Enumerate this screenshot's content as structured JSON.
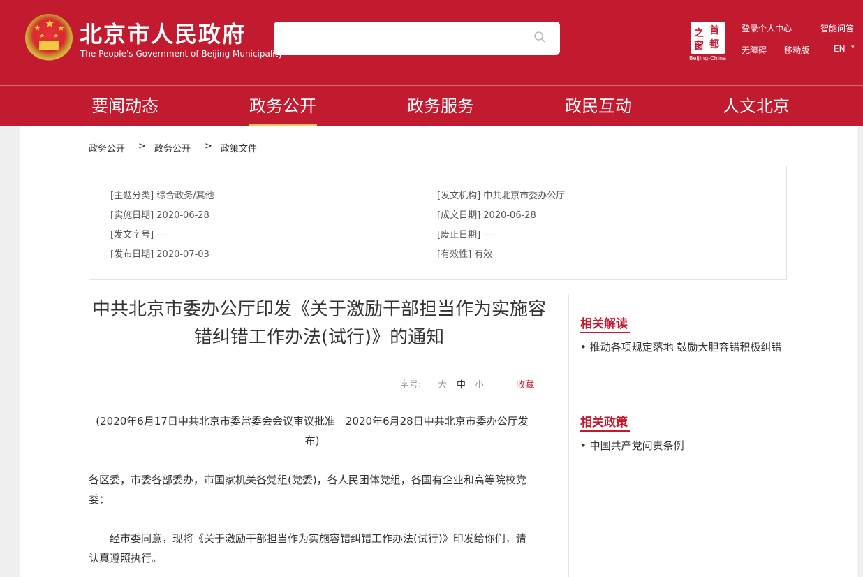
{
  "header": {
    "site_title": "北京市人民政府",
    "site_subtitle": "The People's Government of Beijing Municipality",
    "search_placeholder": "",
    "capital_logo_chars": [
      "首",
      "都",
      "之",
      "窗"
    ],
    "capital_logo_text": "Beijing-China",
    "links": {
      "login": "登录个人中心",
      "smart_qa": "智能问答",
      "accessible": "无障碍",
      "mobile": "移动版",
      "english": "EN",
      "english_arrow": "▾"
    }
  },
  "nav": {
    "items": [
      "要闻动态",
      "政务公开",
      "政务服务",
      "政民互动",
      "人文北京"
    ],
    "active": "政务公开"
  },
  "breadcrumb": {
    "items": [
      "政务公开",
      "政策文件"
    ],
    "first": "政务公开",
    "separator": ">"
  },
  "meta": {
    "topic": "[主题分类] 综合政务/其他",
    "issuer": "[发文机构] 中共北京市委办公厅",
    "effective_date": "[实施日期] 2020-06-28",
    "written_date": "[成文日期] 2020-06-28",
    "doc_number": "[发文字号] ----",
    "abolish_date": "[废止日期] ----",
    "publish_date": "[发布日期] 2020-07-03",
    "validity": "[有效性] 有效"
  },
  "article": {
    "title": "中共北京市委办公厅印发《关于激励干部担当作为实施容错纠错工作办法(试行)》的通知",
    "font_size_label": "字号:",
    "font_sizes": [
      "大",
      "中",
      "小"
    ],
    "current_font_size": "中",
    "favorite_label": "收藏",
    "approval_note": "(2020年6月17日中共北京市委常委会会议审议批准　2020年6月28日中共北京市委办公厅发布)",
    "recipients": "各区委，市委各部委办，市国家机关各党组(党委)，各人民团体党组，各国有企业和高等院校党委：",
    "body_para_1": "经市委同意，现将《关于激励干部担当作为实施容错纠错工作办法(试行)》印发给你们，请认真遵照执行。"
  },
  "sidebar": {
    "related_reading_title": "相关解读",
    "related_reading_items": [
      "推动各项规定落地 鼓励大胆容错积极纠错"
    ],
    "related_policy_title": "相关政策",
    "related_policy_items": [
      "中国共产党问责条例"
    ]
  },
  "colors": {
    "brand_red": "#c21a2e",
    "nav_active_underline": "#f3c15a"
  }
}
